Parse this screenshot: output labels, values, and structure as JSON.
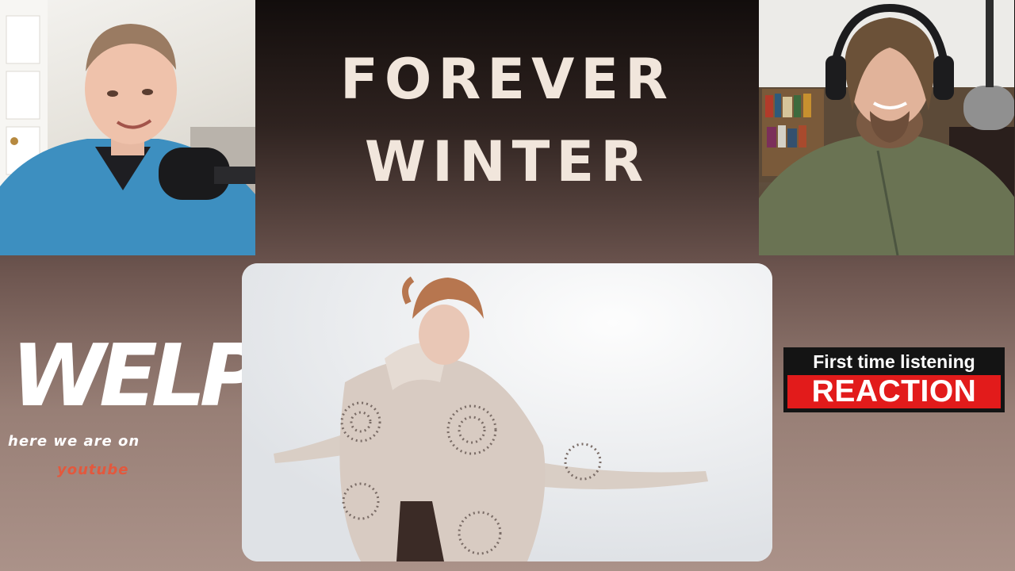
{
  "title": {
    "line1": "FOREVER",
    "line2": "WINTER"
  },
  "logo": {
    "word": "WELP",
    "tagline": "here we are on",
    "sub": "youtube"
  },
  "badge": {
    "top": "First time listening",
    "bottom": "REACTION"
  }
}
